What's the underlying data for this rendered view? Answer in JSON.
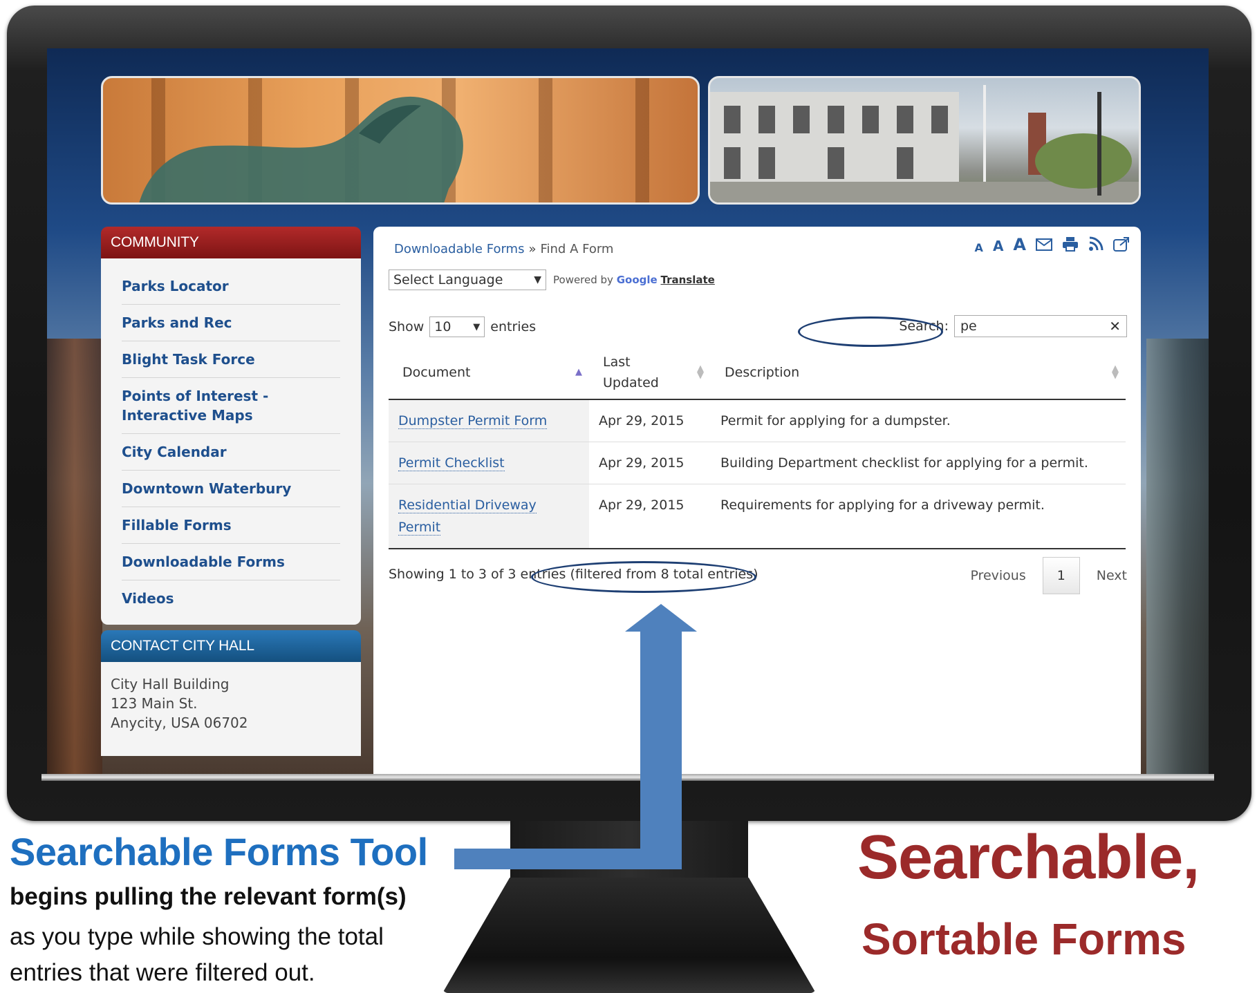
{
  "sidebar": {
    "community_title": "COMMUNITY",
    "items": [
      {
        "label": "Parks Locator"
      },
      {
        "label": "Parks and Rec"
      },
      {
        "label": "Blight Task Force"
      },
      {
        "label": "Points of Interest - Interactive Maps"
      },
      {
        "label": "City Calendar"
      },
      {
        "label": "Downtown Waterbury"
      },
      {
        "label": "Fillable Forms"
      },
      {
        "label": "Downloadable Forms"
      },
      {
        "label": "Videos"
      }
    ],
    "contact_title": "CONTACT CITY HALL",
    "contact_lines": [
      "City Hall Building",
      "123 Main St.",
      "Anycity, USA 06702"
    ]
  },
  "breadcrumb": {
    "parent": "Downloadable Forms",
    "sep": "»",
    "current": "Find A Form"
  },
  "toolbar": {
    "font_small": "A",
    "font_medium": "A",
    "font_large": "A",
    "email_icon": "envelope-icon",
    "print_icon": "printer-icon",
    "rss_icon": "rss-icon",
    "share_icon": "share-icon"
  },
  "language": {
    "select_value": "Select Language",
    "powered_by": "Powered by",
    "google": "Google",
    "translate": "Translate"
  },
  "table_controls": {
    "show_label": "Show",
    "entries_value": "10",
    "entries_label": "entries",
    "search_label": "Search:",
    "search_value": "pe"
  },
  "table": {
    "columns": [
      "Document",
      "Last Updated",
      "Description"
    ],
    "rows": [
      {
        "document": "Dumpster Permit Form",
        "updated": "Apr 29, 2015",
        "description": "Permit for applying for a dumpster."
      },
      {
        "document": "Permit Checklist",
        "updated": "Apr 29, 2015",
        "description": "Building Department checklist for applying for a permit."
      },
      {
        "document": "Residential Driveway Permit",
        "updated": "Apr 29, 2015",
        "description": "Requirements for applying for a driveway permit."
      }
    ]
  },
  "info": {
    "showing": "Showing 1 to 3 of 3 entries (filtered from 8 total entries)"
  },
  "pager": {
    "previous": "Previous",
    "page": "1",
    "next": "Next"
  },
  "callout": {
    "title": "Searchable Forms Tool",
    "bold_line": "begins pulling the relevant form(s)",
    "body": "as you type while showing the total entries that were filtered out."
  },
  "hero": {
    "line1": "Searchable,",
    "line2": "Sortable Forms"
  },
  "colors": {
    "accent_blue": "#4f81bd",
    "hero_red": "#9b2a2a",
    "title_blue": "#1e6fbf",
    "community_red": "#b22a2a",
    "contact_blue": "#2a78b8"
  }
}
